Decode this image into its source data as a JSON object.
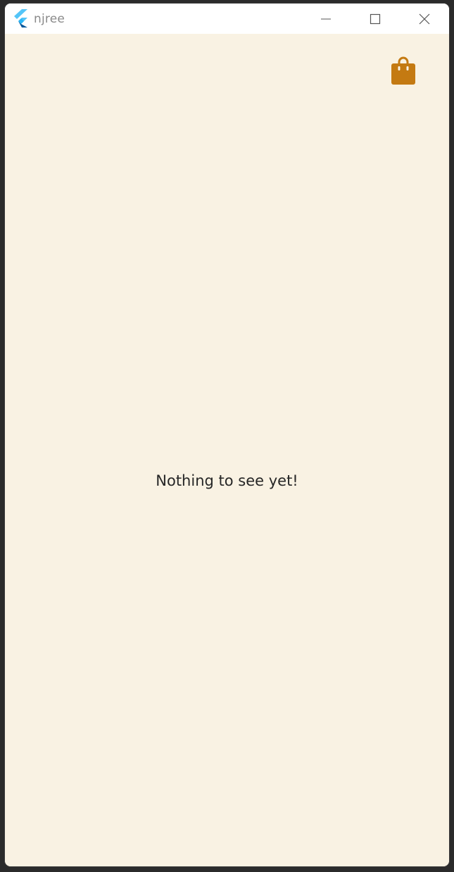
{
  "window": {
    "title": "njree"
  },
  "header": {
    "cart_icon": "shopping-bag-icon"
  },
  "main": {
    "empty_message": "Nothing to see yet!"
  },
  "colors": {
    "background": "#f9f2e3",
    "accent": "#c47a12",
    "text": "#262626"
  }
}
